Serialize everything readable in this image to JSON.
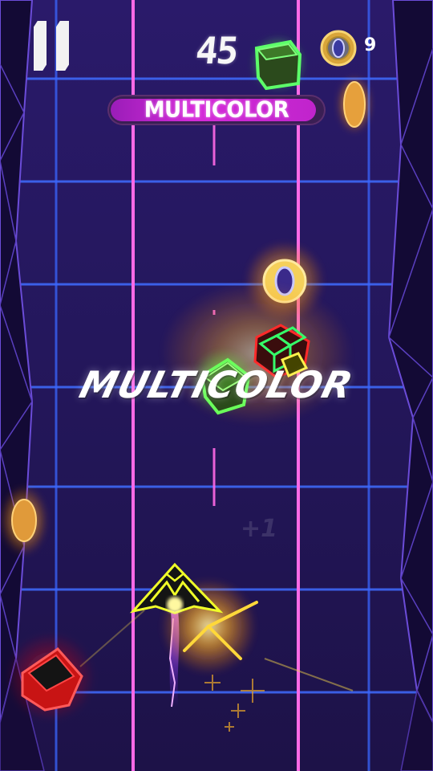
{
  "hud": {
    "score": "45",
    "coin_count": "9"
  },
  "mode_banner": {
    "label": "MULTICOLOR"
  },
  "powerup_popup": {
    "label": "MULTICOLOR"
  },
  "colors": {
    "background": "#24175c",
    "grid_line": "#3f6cff",
    "lane_pink": "#ff5adf",
    "banner_magenta": "#d52bd9",
    "coin_gold": "#e6b64a",
    "cube_green": "#35ff6a",
    "cube_red": "#ff2a2a",
    "ship_yellow": "#ffe000"
  },
  "icons": {
    "pause": "pause-icon",
    "coin": "coin-icon",
    "ship": "spaceship-icon"
  }
}
